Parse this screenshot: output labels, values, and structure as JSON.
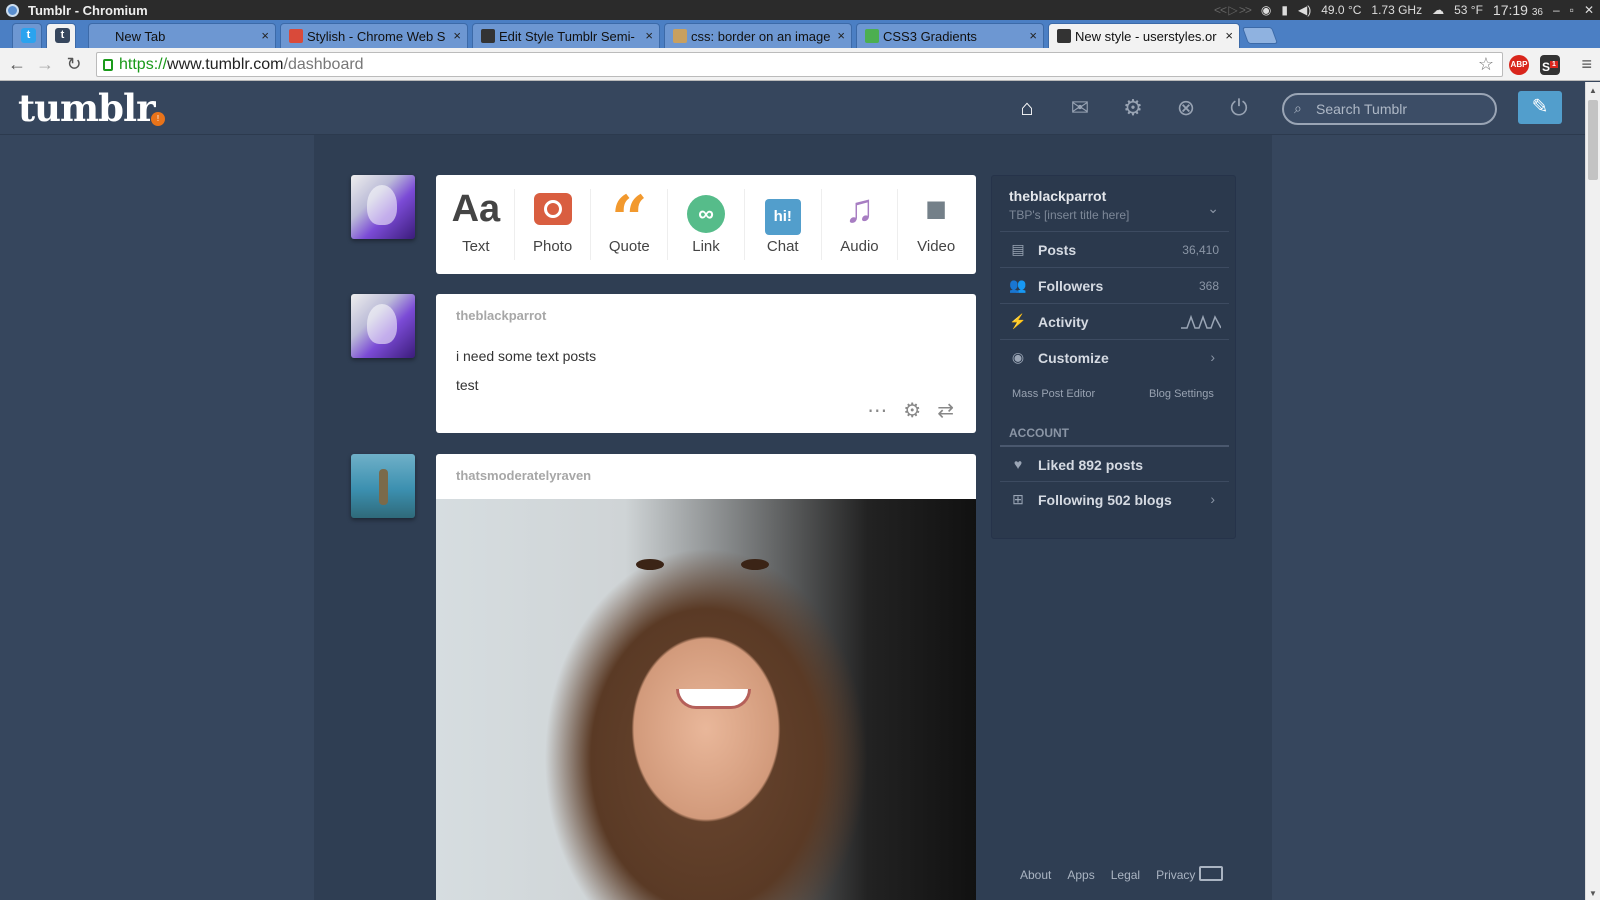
{
  "window": {
    "title": "Tumblr - Chromium",
    "status": {
      "temperature": "49.0 °C",
      "cpu_freq": "1.73 GHz",
      "weather": "53 °F",
      "time": "17:19",
      "seconds": "36"
    }
  },
  "browser": {
    "tabs": [
      {
        "label": "New Tab",
        "favicon_color": "#6d97d2"
      },
      {
        "label": "Stylish - Chrome Web S",
        "favicon_color": "#d94a3a"
      },
      {
        "label": "Edit Style Tumblr Semi-",
        "favicon_color": "#333333"
      },
      {
        "label": "css: border on an image",
        "favicon_color": "#c8a060"
      },
      {
        "label": "CSS3 Gradients",
        "favicon_color": "#4caf50"
      },
      {
        "label": "New style - userstyles.or",
        "favicon_color": "#333333"
      }
    ],
    "url": {
      "scheme": "https://",
      "host": "www.tumblr.com",
      "path": "/dashboard"
    },
    "ext_abp": "ABP",
    "ext_stylish_badge": "1"
  },
  "header": {
    "logo": "tumblr",
    "logo_badge": "!",
    "search_placeholder": "Search Tumblr",
    "accent": "#529ecc"
  },
  "post_form": [
    {
      "label": "Text",
      "icon": "Aa",
      "color": "#444444"
    },
    {
      "label": "Photo",
      "icon": "camera",
      "color": "#d95e40"
    },
    {
      "label": "Quote",
      "icon": "quote",
      "color": "#f2992e"
    },
    {
      "label": "Link",
      "icon": "link",
      "color": "#56bc8a"
    },
    {
      "label": "Chat",
      "icon": "hi!",
      "color": "#529ecc"
    },
    {
      "label": "Audio",
      "icon": "headphones",
      "color": "#a77dc2"
    },
    {
      "label": "Video",
      "icon": "camera-video",
      "color": "#748089"
    }
  ],
  "posts": [
    {
      "author": "theblackparrot",
      "lines": [
        "i need some text posts",
        "test"
      ]
    },
    {
      "author": "thatsmoderatelyraven"
    }
  ],
  "sidebar": {
    "blog_name": "theblackparrot",
    "blog_title": "TBP's [insert title here]",
    "posts_label": "Posts",
    "posts_count": "36,410",
    "followers_label": "Followers",
    "followers_count": "368",
    "activity_label": "Activity",
    "customize_label": "Customize",
    "mass_post_editor": "Mass Post Editor",
    "blog_settings": "Blog Settings",
    "account_heading": "ACCOUNT",
    "liked_label": "Liked 892 posts",
    "following_label": "Following 502 blogs"
  },
  "footer": [
    "About",
    "Apps",
    "Legal",
    "Privacy"
  ]
}
